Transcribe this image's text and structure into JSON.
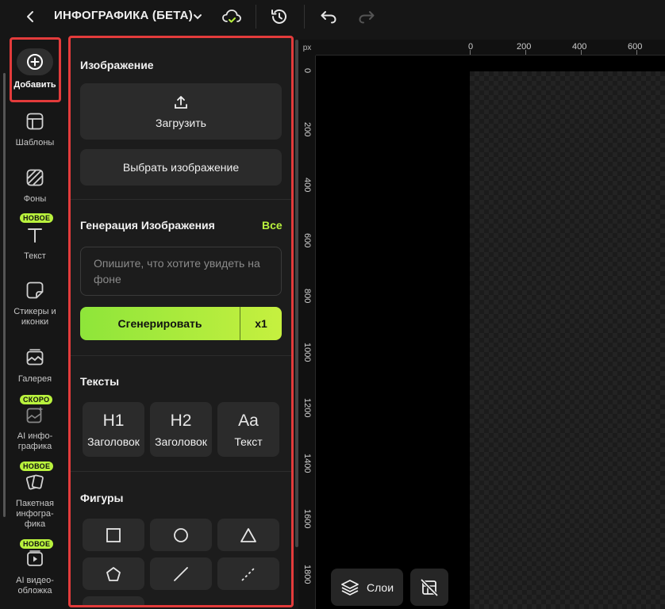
{
  "header": {
    "back_icon": "chevron-left-icon",
    "title": "ИНФОГРАФИКА (БЕТА)",
    "title_dropdown_icon": "chevron-down-icon",
    "cloud_icon": "cloud-check-icon",
    "history_icon": "history-icon",
    "undo_icon": "undo-icon",
    "redo_icon": "redo-icon"
  },
  "sidebar": {
    "items": [
      {
        "label": "Добавить",
        "icon": "plus-circle-icon"
      },
      {
        "label": "Шаблоны",
        "icon": "layout-template-icon"
      },
      {
        "label": "Фоны",
        "icon": "pattern-icon"
      },
      {
        "label": "Текст",
        "icon": "text-icon",
        "badge": "НОВОЕ"
      },
      {
        "label": "Стикеры и иконки",
        "icon": "sticker-icon"
      },
      {
        "label": "Галерея",
        "icon": "gallery-icon"
      },
      {
        "label": "AI инфо-графика",
        "icon": "ai-image-icon",
        "badge": "СКОРО"
      },
      {
        "label": "Пакетная инфогра-фика",
        "icon": "batch-cards-icon",
        "badge": "НОВОЕ"
      },
      {
        "label": "AI видео-обложка",
        "icon": "video-cover-icon",
        "badge": "НОВОЕ"
      }
    ]
  },
  "panel": {
    "image_section": {
      "title": "Изображение",
      "upload_label": "Загрузить",
      "upload_icon": "upload-icon",
      "choose_label": "Выбрать изображение"
    },
    "generation_section": {
      "title": "Генерация Изображения",
      "all_link": "Все",
      "prompt_placeholder": "Опишите, что хотите увидеть на фоне",
      "generate_label": "Сгенерировать",
      "multiplier": "x1"
    },
    "texts_section": {
      "title": "Тексты",
      "items": [
        {
          "glyph": "H1",
          "label": "Заголовок"
        },
        {
          "glyph": "H2",
          "label": "Заголовок"
        },
        {
          "glyph": "Aa",
          "label": "Текст"
        }
      ]
    },
    "shapes_section": {
      "title": "Фигуры",
      "items": [
        "square-icon",
        "circle-icon",
        "triangle-icon",
        "pentagon-icon",
        "line-icon",
        "dashed-line-icon"
      ]
    }
  },
  "canvas": {
    "unit": "px",
    "top_ruler": [
      "0",
      "200",
      "400",
      "600"
    ],
    "left_ruler": [
      "0",
      "200",
      "400",
      "600",
      "800",
      "1000",
      "1200",
      "1400",
      "1600",
      "1800"
    ],
    "layers_label": "Слои",
    "layers_icon": "layers-icon",
    "toggle_icon": "slash-layout-icon"
  },
  "colors": {
    "accent": "#b9f23d",
    "highlight": "#e33b3b",
    "background": "#161616"
  }
}
